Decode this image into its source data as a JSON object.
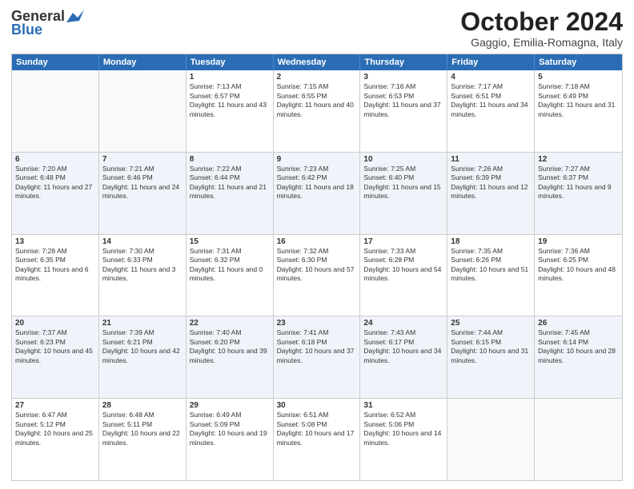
{
  "header": {
    "logo_general": "General",
    "logo_blue": "Blue",
    "month_title": "October 2024",
    "location": "Gaggio, Emilia-Romagna, Italy"
  },
  "weekdays": [
    "Sunday",
    "Monday",
    "Tuesday",
    "Wednesday",
    "Thursday",
    "Friday",
    "Saturday"
  ],
  "rows": [
    [
      {
        "day": "",
        "info": ""
      },
      {
        "day": "",
        "info": ""
      },
      {
        "day": "1",
        "info": "Sunrise: 7:13 AM\nSunset: 6:57 PM\nDaylight: 11 hours and 43 minutes."
      },
      {
        "day": "2",
        "info": "Sunrise: 7:15 AM\nSunset: 6:55 PM\nDaylight: 11 hours and 40 minutes."
      },
      {
        "day": "3",
        "info": "Sunrise: 7:16 AM\nSunset: 6:53 PM\nDaylight: 11 hours and 37 minutes."
      },
      {
        "day": "4",
        "info": "Sunrise: 7:17 AM\nSunset: 6:51 PM\nDaylight: 11 hours and 34 minutes."
      },
      {
        "day": "5",
        "info": "Sunrise: 7:18 AM\nSunset: 6:49 PM\nDaylight: 11 hours and 31 minutes."
      }
    ],
    [
      {
        "day": "6",
        "info": "Sunrise: 7:20 AM\nSunset: 6:48 PM\nDaylight: 11 hours and 27 minutes."
      },
      {
        "day": "7",
        "info": "Sunrise: 7:21 AM\nSunset: 6:46 PM\nDaylight: 11 hours and 24 minutes."
      },
      {
        "day": "8",
        "info": "Sunrise: 7:22 AM\nSunset: 6:44 PM\nDaylight: 11 hours and 21 minutes."
      },
      {
        "day": "9",
        "info": "Sunrise: 7:23 AM\nSunset: 6:42 PM\nDaylight: 11 hours and 18 minutes."
      },
      {
        "day": "10",
        "info": "Sunrise: 7:25 AM\nSunset: 6:40 PM\nDaylight: 11 hours and 15 minutes."
      },
      {
        "day": "11",
        "info": "Sunrise: 7:26 AM\nSunset: 6:39 PM\nDaylight: 11 hours and 12 minutes."
      },
      {
        "day": "12",
        "info": "Sunrise: 7:27 AM\nSunset: 6:37 PM\nDaylight: 11 hours and 9 minutes."
      }
    ],
    [
      {
        "day": "13",
        "info": "Sunrise: 7:28 AM\nSunset: 6:35 PM\nDaylight: 11 hours and 6 minutes."
      },
      {
        "day": "14",
        "info": "Sunrise: 7:30 AM\nSunset: 6:33 PM\nDaylight: 11 hours and 3 minutes."
      },
      {
        "day": "15",
        "info": "Sunrise: 7:31 AM\nSunset: 6:32 PM\nDaylight: 11 hours and 0 minutes."
      },
      {
        "day": "16",
        "info": "Sunrise: 7:32 AM\nSunset: 6:30 PM\nDaylight: 10 hours and 57 minutes."
      },
      {
        "day": "17",
        "info": "Sunrise: 7:33 AM\nSunset: 6:28 PM\nDaylight: 10 hours and 54 minutes."
      },
      {
        "day": "18",
        "info": "Sunrise: 7:35 AM\nSunset: 6:26 PM\nDaylight: 10 hours and 51 minutes."
      },
      {
        "day": "19",
        "info": "Sunrise: 7:36 AM\nSunset: 6:25 PM\nDaylight: 10 hours and 48 minutes."
      }
    ],
    [
      {
        "day": "20",
        "info": "Sunrise: 7:37 AM\nSunset: 6:23 PM\nDaylight: 10 hours and 45 minutes."
      },
      {
        "day": "21",
        "info": "Sunrise: 7:39 AM\nSunset: 6:21 PM\nDaylight: 10 hours and 42 minutes."
      },
      {
        "day": "22",
        "info": "Sunrise: 7:40 AM\nSunset: 6:20 PM\nDaylight: 10 hours and 39 minutes."
      },
      {
        "day": "23",
        "info": "Sunrise: 7:41 AM\nSunset: 6:18 PM\nDaylight: 10 hours and 37 minutes."
      },
      {
        "day": "24",
        "info": "Sunrise: 7:43 AM\nSunset: 6:17 PM\nDaylight: 10 hours and 34 minutes."
      },
      {
        "day": "25",
        "info": "Sunrise: 7:44 AM\nSunset: 6:15 PM\nDaylight: 10 hours and 31 minutes."
      },
      {
        "day": "26",
        "info": "Sunrise: 7:45 AM\nSunset: 6:14 PM\nDaylight: 10 hours and 28 minutes."
      }
    ],
    [
      {
        "day": "27",
        "info": "Sunrise: 6:47 AM\nSunset: 5:12 PM\nDaylight: 10 hours and 25 minutes."
      },
      {
        "day": "28",
        "info": "Sunrise: 6:48 AM\nSunset: 5:11 PM\nDaylight: 10 hours and 22 minutes."
      },
      {
        "day": "29",
        "info": "Sunrise: 6:49 AM\nSunset: 5:09 PM\nDaylight: 10 hours and 19 minutes."
      },
      {
        "day": "30",
        "info": "Sunrise: 6:51 AM\nSunset: 5:08 PM\nDaylight: 10 hours and 17 minutes."
      },
      {
        "day": "31",
        "info": "Sunrise: 6:52 AM\nSunset: 5:06 PM\nDaylight: 10 hours and 14 minutes."
      },
      {
        "day": "",
        "info": ""
      },
      {
        "day": "",
        "info": ""
      }
    ]
  ]
}
